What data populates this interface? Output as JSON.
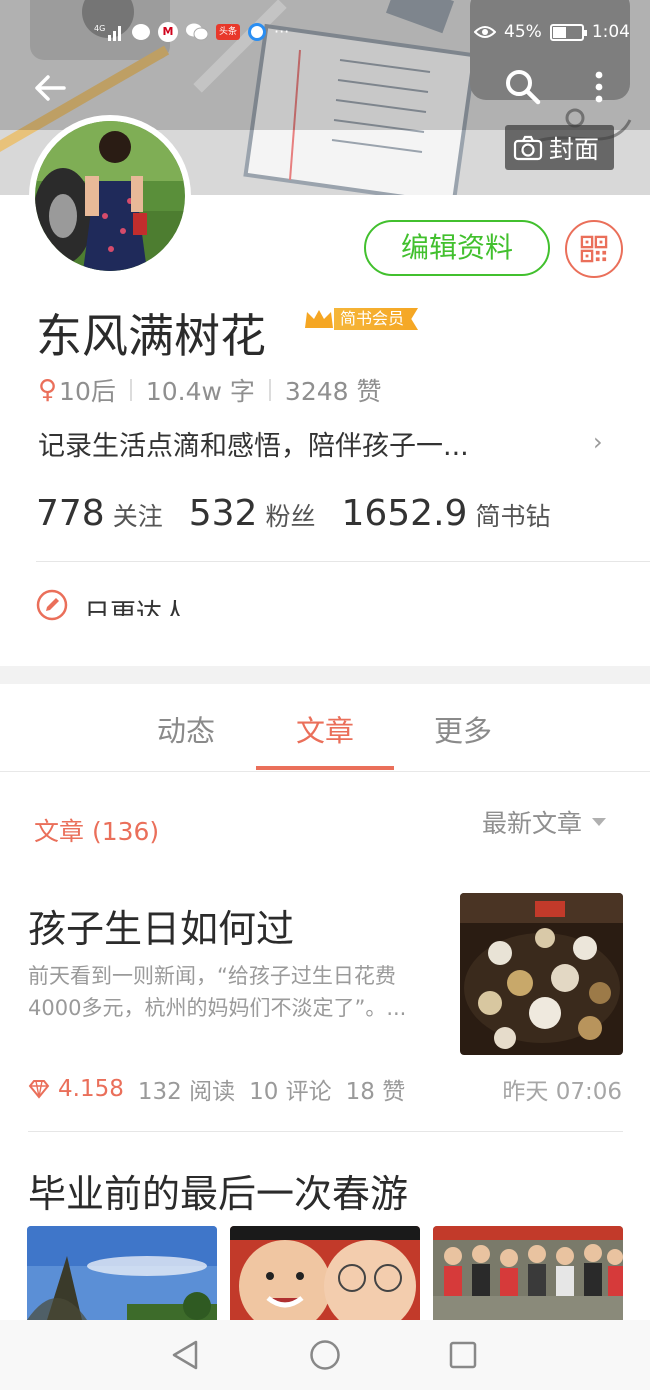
{
  "status_bar": {
    "signal_label": "4G",
    "mcd_label": "M",
    "news_label": "头条",
    "more": "···",
    "battery": "45%",
    "battery_level": 0.45,
    "time": "1:04"
  },
  "header": {
    "back_icon": "arrow-left-icon",
    "search_icon": "search-icon",
    "more_icon": "more-vertical-icon",
    "cover_button_label": "封面"
  },
  "profile": {
    "username": "东风满树花",
    "vip_label": "简书会员",
    "edit_label": "编辑资料",
    "gender_symbol": "♀",
    "age_group": "10后",
    "word_count": "10.4w 字",
    "likes": "3248 赞",
    "bio": "记录生活点滴和感悟，陪伴孩子一...",
    "bio_chevron": "›",
    "counts": [
      {
        "num": "778",
        "label": "关注"
      },
      {
        "num": "532",
        "label": "粉丝"
      },
      {
        "num": "1652.9",
        "label": "简书钻"
      }
    ],
    "editor_label": "日更达人"
  },
  "tabs": [
    {
      "label": "动态",
      "active": false
    },
    {
      "label": "文章",
      "active": true
    },
    {
      "label": "更多",
      "active": false
    }
  ],
  "list": {
    "header": "文章 (136)",
    "sort": "最新文章"
  },
  "articles": [
    {
      "title": "孩子生日如何过",
      "summary": "前天看到一则新闻，“给孩子过生日花费4000多元，杭州的妈妈们不淡定了”。...",
      "diamonds": "4.158",
      "reads": "132 阅读",
      "comments": "10 评论",
      "likes": "18 赞",
      "time": "昨天 07:06"
    },
    {
      "title": "毕业前的最后一次春游"
    }
  ],
  "nav": {
    "back": "triangle-back-icon",
    "home": "circle-home-icon",
    "recent": "square-recent-icon"
  },
  "colors": {
    "accent": "#ea6f5a",
    "edit_green": "#42c02e"
  }
}
